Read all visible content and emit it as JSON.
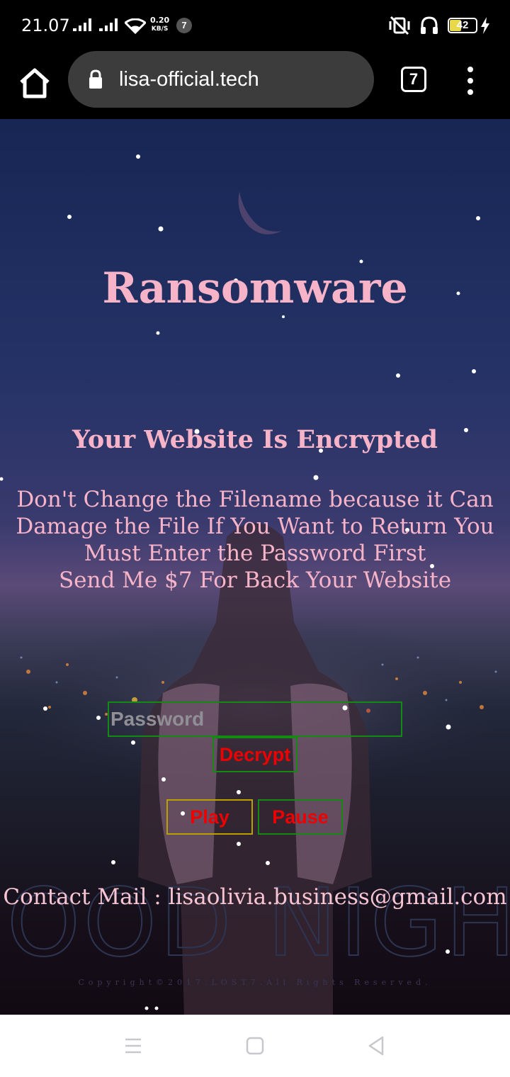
{
  "status_bar": {
    "time": "21.07",
    "network_speed_value": "0.20",
    "network_speed_unit": "KB/S",
    "notification_count": "7",
    "battery_level": "42",
    "icons": [
      "signal-icon",
      "wifi-icon",
      "vibrate-off-icon",
      "headphones-icon",
      "battery-icon",
      "charging-icon"
    ]
  },
  "browser": {
    "url": "lisa-official.tech",
    "tab_count": "7",
    "icons": [
      "home-icon",
      "lock-icon",
      "tabs-icon",
      "more-vert-icon"
    ]
  },
  "page": {
    "title": "Ransomware",
    "subtitle": "Your Website Is Encrypted",
    "message_lines": [
      "Don't Change the Filename because it Can",
      "Damage the File If You Want to Return You",
      "Must Enter the Password First",
      "Send Me $7 For Back Your Website"
    ],
    "password_placeholder": "Password",
    "decrypt_label": "Decrypt",
    "play_label": "Play",
    "pause_label": "Pause",
    "background_text": "GOOD NIGHT",
    "contact": "Contact Mail : lisaolivia.business@gmail.com",
    "copyright": "Copyright©2017.LOST7.All Rights Reserved.",
    "colors": {
      "text_pink": "#f7b3c8",
      "button_text": "#ee0000",
      "border_green": "#148a14",
      "border_yellow": "#bba000"
    }
  },
  "nav_bar": {
    "icons": [
      "recent-apps-icon",
      "home-nav-icon",
      "back-icon"
    ]
  }
}
